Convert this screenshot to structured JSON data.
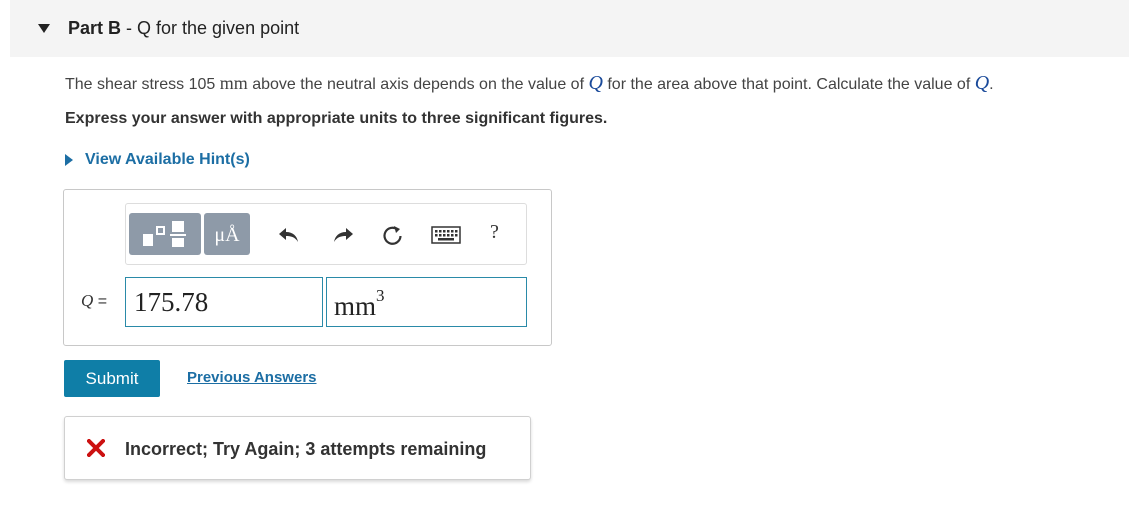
{
  "part": {
    "label": "Part B",
    "separator": " - ",
    "title": "Q for the given point"
  },
  "question": {
    "text_1": "The shear stress 105 ",
    "unit_mm": "mm",
    "text_2": " above the neutral axis depends on the value of ",
    "var_q": "Q",
    "text_3": " for the area above that point. Calculate the value of ",
    "var_q2": "Q",
    "text_4": "."
  },
  "instruction": "Express your answer with appropriate units to three significant figures.",
  "hint_link": "View Available Hint(s)",
  "toolbar": {
    "units_label": "μÅ",
    "help_label": "?",
    "icons": [
      "templates-icon",
      "units-icon",
      "undo-icon",
      "redo-icon",
      "reset-icon",
      "keyboard-icon",
      "help-icon"
    ]
  },
  "answer": {
    "var_label": "Q",
    "equals": " =",
    "value": "175.78",
    "unit_base": "mm",
    "unit_exp": "3"
  },
  "submit_label": "Submit",
  "previous_answers_label": "Previous Answers",
  "feedback": {
    "text": "Incorrect; Try Again; 3 attempts remaining",
    "status_color": "#cc1111"
  },
  "colors": {
    "accent": "#0f7ea7",
    "link": "#1c6ea4",
    "toolbar_button": "#8e9aa8"
  }
}
